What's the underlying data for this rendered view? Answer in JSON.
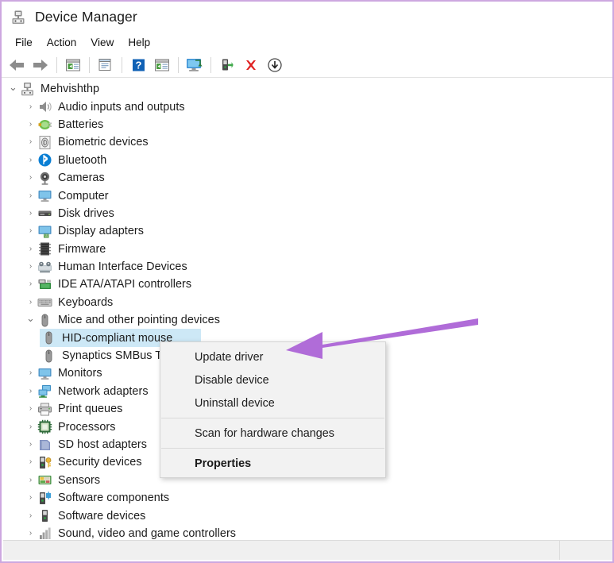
{
  "window": {
    "title": "Device Manager",
    "title_icon": "device-manager-icon",
    "border_color": "#cda8e0"
  },
  "menubar": {
    "items": [
      {
        "label": "File",
        "name": "menu-file"
      },
      {
        "label": "Action",
        "name": "menu-action"
      },
      {
        "label": "View",
        "name": "menu-view"
      },
      {
        "label": "Help",
        "name": "menu-help"
      }
    ]
  },
  "toolbar": {
    "buttons": [
      {
        "icon": "back-arrow-icon",
        "label": "Back"
      },
      {
        "icon": "forward-arrow-icon",
        "label": "Forward"
      },
      {
        "icon": "show-hide-console-tree-icon",
        "label": "Show/Hide Console Tree"
      },
      {
        "icon": "properties-icon",
        "label": "Properties"
      },
      {
        "icon": "help-icon",
        "label": "Help"
      },
      {
        "icon": "show-hide-action-pane-icon",
        "label": "Show/Hide Action Pane"
      },
      {
        "icon": "scan-hardware-changes-icon",
        "label": "Scan for hardware changes"
      },
      {
        "icon": "update-driver-icon",
        "label": "Update driver"
      },
      {
        "icon": "uninstall-device-icon",
        "label": "Uninstall device"
      },
      {
        "icon": "disable-device-icon",
        "label": "Disable device"
      }
    ]
  },
  "tree": {
    "nodes": [
      {
        "label": "Mehvishthp",
        "level": 0,
        "expanded": true,
        "icon": "computer-root-icon",
        "selected": false
      },
      {
        "label": "Audio inputs and outputs",
        "level": 1,
        "expanded": false,
        "icon": "speaker-icon",
        "selected": false
      },
      {
        "label": "Batteries",
        "level": 1,
        "expanded": false,
        "icon": "battery-icon",
        "selected": false
      },
      {
        "label": "Biometric devices",
        "level": 1,
        "expanded": false,
        "icon": "fingerprint-icon",
        "selected": false
      },
      {
        "label": "Bluetooth",
        "level": 1,
        "expanded": false,
        "icon": "bluetooth-icon",
        "selected": false
      },
      {
        "label": "Cameras",
        "level": 1,
        "expanded": false,
        "icon": "camera-icon",
        "selected": false
      },
      {
        "label": "Computer",
        "level": 1,
        "expanded": false,
        "icon": "monitor-icon",
        "selected": false
      },
      {
        "label": "Disk drives",
        "level": 1,
        "expanded": false,
        "icon": "disk-drive-icon",
        "selected": false
      },
      {
        "label": "Display adapters",
        "level": 1,
        "expanded": false,
        "icon": "display-adapter-icon",
        "selected": false
      },
      {
        "label": "Firmware",
        "level": 1,
        "expanded": false,
        "icon": "firmware-chip-icon",
        "selected": false
      },
      {
        "label": "Human Interface Devices",
        "level": 1,
        "expanded": false,
        "icon": "hid-icon",
        "selected": false
      },
      {
        "label": "IDE ATA/ATAPI controllers",
        "level": 1,
        "expanded": false,
        "icon": "ide-controller-icon",
        "selected": false
      },
      {
        "label": "Keyboards",
        "level": 1,
        "expanded": false,
        "icon": "keyboard-icon",
        "selected": false
      },
      {
        "label": "Mice and other pointing devices",
        "level": 1,
        "expanded": true,
        "icon": "mouse-icon",
        "selected": false
      },
      {
        "label": "HID-compliant mouse",
        "level": 2,
        "expanded": false,
        "icon": "mouse-icon",
        "selected": true
      },
      {
        "label": "Synaptics SMBus TouchPad",
        "level": 2,
        "expanded": false,
        "icon": "mouse-icon",
        "selected": false
      },
      {
        "label": "Monitors",
        "level": 1,
        "expanded": false,
        "icon": "monitor-icon",
        "selected": false
      },
      {
        "label": "Network adapters",
        "level": 1,
        "expanded": false,
        "icon": "network-adapter-icon",
        "selected": false
      },
      {
        "label": "Print queues",
        "level": 1,
        "expanded": false,
        "icon": "printer-icon",
        "selected": false
      },
      {
        "label": "Processors",
        "level": 1,
        "expanded": false,
        "icon": "processor-icon",
        "selected": false
      },
      {
        "label": "SD host adapters",
        "level": 1,
        "expanded": false,
        "icon": "sd-host-adapter-icon",
        "selected": false
      },
      {
        "label": "Security devices",
        "level": 1,
        "expanded": false,
        "icon": "security-device-icon",
        "selected": false
      },
      {
        "label": "Sensors",
        "level": 1,
        "expanded": false,
        "icon": "sensor-icon",
        "selected": false
      },
      {
        "label": "Software components",
        "level": 1,
        "expanded": false,
        "icon": "software-component-icon",
        "selected": false
      },
      {
        "label": "Software devices",
        "level": 1,
        "expanded": false,
        "icon": "software-device-icon",
        "selected": false
      },
      {
        "label": "Sound, video and game controllers",
        "level": 1,
        "expanded": false,
        "icon": "sound-controller-icon",
        "selected": false
      }
    ],
    "selection_highlight_color": "#cde8f6"
  },
  "context_menu": {
    "items": [
      {
        "label": "Update driver",
        "bold": false,
        "separator_after": false,
        "name": "ctx-update-driver"
      },
      {
        "label": "Disable device",
        "bold": false,
        "separator_after": false,
        "name": "ctx-disable-device"
      },
      {
        "label": "Uninstall device",
        "bold": false,
        "separator_after": true,
        "name": "ctx-uninstall-device"
      },
      {
        "label": "Scan for hardware changes",
        "bold": false,
        "separator_after": true,
        "name": "ctx-scan-hardware-changes"
      },
      {
        "label": "Properties",
        "bold": true,
        "separator_after": false,
        "name": "ctx-properties"
      }
    ]
  },
  "annotation": {
    "arrow_color": "#b06cd8",
    "points_to": "Update driver"
  }
}
